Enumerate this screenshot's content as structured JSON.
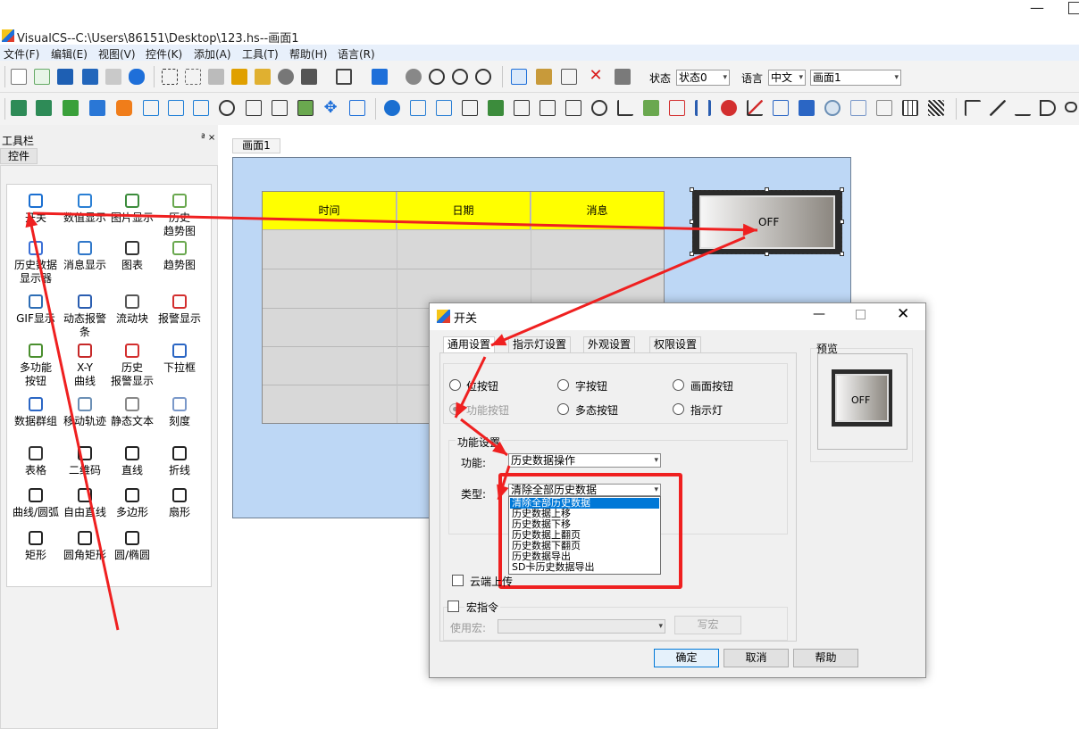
{
  "app": {
    "title": "VisualCS--C:\\Users\\86151\\Desktop\\123.hs--画面1",
    "minimize": "—"
  },
  "menu": [
    "文件(F)",
    "编辑(E)",
    "视图(V)",
    "控件(K)",
    "添加(A)",
    "工具(T)",
    "帮助(H)",
    "语言(R)"
  ],
  "toolbar": {
    "state_label": "状态",
    "state_value": "状态0",
    "lang_label": "语言",
    "lang_value": "中文",
    "screen_value": "画面1"
  },
  "toolpanel": {
    "title": "工具栏",
    "pin": "ª ×",
    "tab": "控件",
    "items": [
      {
        "label": "开关",
        "icon": "power-icon",
        "color": "#1a6fd1"
      },
      {
        "label": "数值显示",
        "icon": "numeric-display-icon",
        "color": "#2a7fd4"
      },
      {
        "label": "图片显示",
        "icon": "picture-icon",
        "color": "#3c8c3c"
      },
      {
        "label": "历史\n趋势图",
        "icon": "history-trend-icon",
        "color": "#6aa84f"
      },
      {
        "label": "历史数据\n显示器",
        "icon": "history-data-icon",
        "color": "#3b6fd6"
      },
      {
        "label": "消息显示",
        "icon": "message-icon",
        "color": "#2f77c9"
      },
      {
        "label": "图表",
        "icon": "gauge-icon",
        "color": "#333333"
      },
      {
        "label": "趋势图",
        "icon": "trend-icon",
        "color": "#6aa84f"
      },
      {
        "label": "GIF显示",
        "icon": "gif-icon",
        "color": "#2d6db5"
      },
      {
        "label": "动态报警条",
        "icon": "alarm-bar-icon",
        "color": "#2a5db0"
      },
      {
        "label": "流动块",
        "icon": "flow-block-icon",
        "color": "#555555"
      },
      {
        "label": "报警显示",
        "icon": "alarm-display-icon",
        "color": "#d32f2f"
      },
      {
        "label": "多功能\n按钮",
        "icon": "multi-button-icon",
        "color": "#4a8f2e"
      },
      {
        "label": "X-Y\n曲线",
        "icon": "xy-curve-icon",
        "color": "#c62828"
      },
      {
        "label": "历史\n报警显示",
        "icon": "history-alarm-icon",
        "color": "#d32f2f"
      },
      {
        "label": "下拉框",
        "icon": "dropdown-icon",
        "color": "#2b66c4"
      },
      {
        "label": "数据群组",
        "icon": "data-group-icon",
        "color": "#2b66c4"
      },
      {
        "label": "移动轨迹",
        "icon": "move-track-icon",
        "color": "#6b8fb5"
      },
      {
        "label": "静态文本",
        "icon": "static-text-icon",
        "color": "#888888"
      },
      {
        "label": "刻度",
        "icon": "scale-icon",
        "color": "#7a98c9"
      },
      {
        "label": "表格",
        "icon": "table-icon",
        "color": "#333333"
      },
      {
        "label": "二维码",
        "icon": "qrcode-icon",
        "color": "#222222"
      },
      {
        "label": "直线",
        "icon": "line-icon",
        "color": "#222222"
      },
      {
        "label": "折线",
        "icon": "polyline-icon",
        "color": "#222222"
      },
      {
        "label": "曲线/圆弧",
        "icon": "curve-icon",
        "color": "#222222"
      },
      {
        "label": "自由直线",
        "icon": "freeline-icon",
        "color": "#222222"
      },
      {
        "label": "多边形",
        "icon": "polygon-icon",
        "color": "#222222"
      },
      {
        "label": "扇形",
        "icon": "sector-icon",
        "color": "#222222"
      },
      {
        "label": "矩形",
        "icon": "rect-icon",
        "color": "#222222"
      },
      {
        "label": "圆角矩形",
        "icon": "round-rect-icon",
        "color": "#222222"
      },
      {
        "label": "圆/椭圆",
        "icon": "ellipse-icon",
        "color": "#222222"
      }
    ]
  },
  "canvas": {
    "tab": "画面1",
    "table_headers": [
      "时间",
      "日期",
      "消息"
    ],
    "switch_text": "OFF"
  },
  "dialog": {
    "title": "开关",
    "tabs": [
      "通用设置",
      "指示灯设置",
      "外观设置",
      "权限设置"
    ],
    "radios": [
      {
        "label": "位按钮",
        "checked": false,
        "disabled": false
      },
      {
        "label": "字按钮",
        "checked": false,
        "disabled": false
      },
      {
        "label": "画面按钮",
        "checked": false,
        "disabled": false
      },
      {
        "label": "功能按钮",
        "checked": true,
        "disabled": true
      },
      {
        "label": "多态按钮",
        "checked": false,
        "disabled": false
      },
      {
        "label": "指示灯",
        "checked": false,
        "disabled": false
      }
    ],
    "func_group_label": "功能设置",
    "func_label": "功能:",
    "func_value": "历史数据操作",
    "type_label": "类型:",
    "type_value": "清除全部历史数据",
    "type_options": [
      "清除全部历史数据",
      "历史数据上移",
      "历史数据下移",
      "历史数据上翻页",
      "历史数据下翻页",
      "历史数据导出",
      "SD卡历史数据导出"
    ],
    "cloud_upload": "云端上传",
    "macro_label": "宏指令",
    "use_macro_label": "使用宏:",
    "write_macro": "写宏",
    "ok": "确定",
    "cancel": "取消",
    "help": "帮助",
    "preview_label": "预览",
    "preview_text": "OFF"
  },
  "colors": {
    "annotation": "#ef2020",
    "table_header": "#ffff00",
    "canvas_bg": "#bdd7f5",
    "selection": "#0078d7"
  }
}
